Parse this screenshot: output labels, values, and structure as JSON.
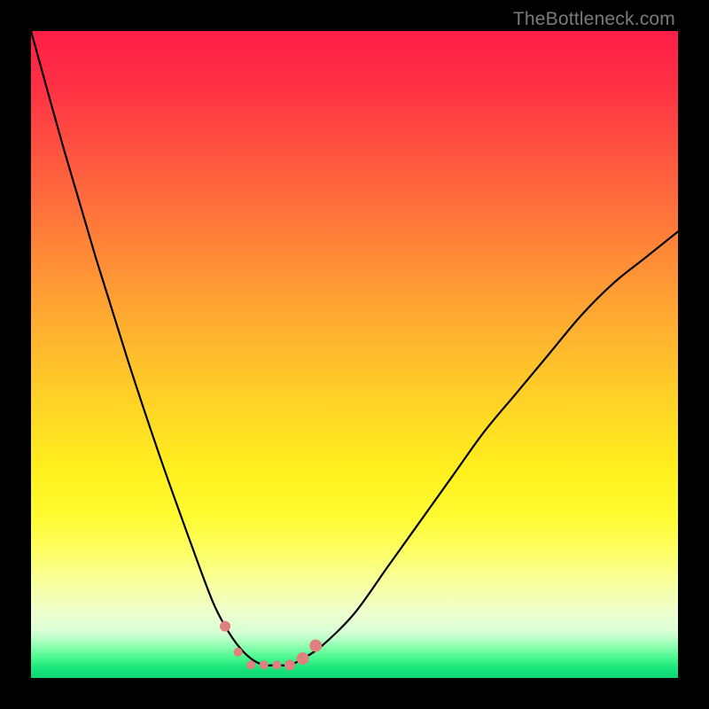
{
  "attribution": "TheBottleneck.com",
  "colors": {
    "background": "#000000",
    "gradient_top": "#ff1e47",
    "gradient_mid": "#ffe11e",
    "gradient_bottom": "#0fd873",
    "curve_stroke": "#000000",
    "marker_fill": "#e08080",
    "attribution_text": "#7a7a7a"
  },
  "chart_data": {
    "type": "line",
    "title": "",
    "xlabel": "",
    "ylabel": "",
    "xlim": [
      0,
      100
    ],
    "ylim": [
      0,
      100
    ],
    "x": [
      0,
      5,
      10,
      15,
      20,
      25,
      28,
      30,
      32,
      34,
      36,
      38,
      40,
      42,
      45,
      50,
      55,
      60,
      65,
      70,
      75,
      80,
      85,
      90,
      95,
      100
    ],
    "series": [
      {
        "name": "bottleneck-curve",
        "values": [
          100,
          82,
          65,
          49,
          34,
          20,
          12,
          8,
          5,
          3,
          2,
          2,
          2,
          3,
          5,
          10,
          17,
          24,
          31,
          38,
          44,
          50,
          56,
          61,
          65,
          69
        ]
      }
    ],
    "markers": {
      "name": "optimal-range-markers",
      "x": [
        30,
        32,
        34,
        36,
        38,
        40,
        42,
        44
      ],
      "y": [
        8,
        4,
        2,
        2,
        2,
        2,
        3,
        5
      ],
      "size": [
        6,
        5,
        5,
        5,
        5,
        6,
        7,
        7
      ]
    },
    "legend": false,
    "grid": false
  }
}
